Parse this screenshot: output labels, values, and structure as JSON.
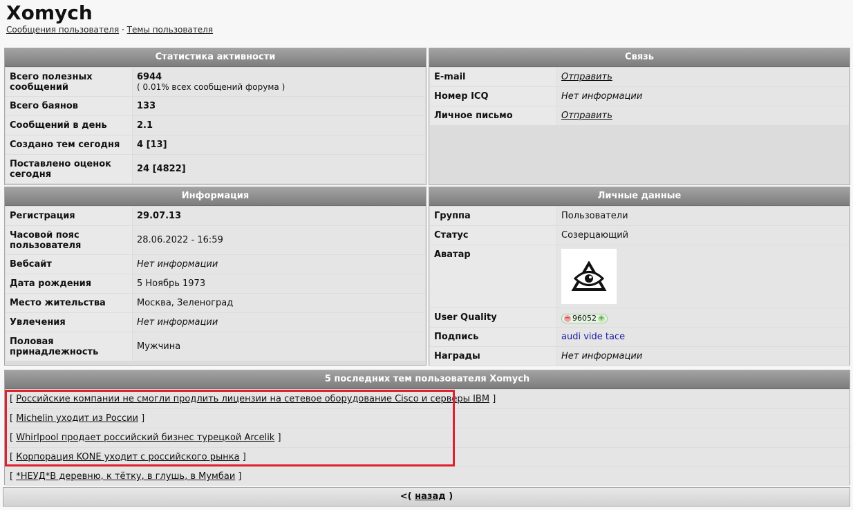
{
  "header": {
    "title": "Xomych",
    "link_posts": "Сообщения пользователя",
    "separator": "·",
    "link_topics": "Темы пользователя"
  },
  "activity": {
    "title": "Статистика активности",
    "rows": [
      {
        "label": "Всего полезных сообщений",
        "value": "6944",
        "sub": "( 0.01% всех сообщений форума )"
      },
      {
        "label": "Всего баянов",
        "value": "133"
      },
      {
        "label": "Сообщений в день",
        "value": "2.1"
      },
      {
        "label": "Создано тем сегодня",
        "value": "4 [13]"
      },
      {
        "label": "Поставлено оценок сегодня",
        "value": "24 [4822]"
      }
    ]
  },
  "contact": {
    "title": "Связь",
    "rows": [
      {
        "label": "E-mail",
        "value": "Отправить"
      },
      {
        "label": "Номер ICQ",
        "value": "Нет информации"
      },
      {
        "label": "Личное письмо",
        "value": "Отправить"
      }
    ]
  },
  "info": {
    "title": "Информация",
    "rows": [
      {
        "label": "Регистрация",
        "value": "29.07.13"
      },
      {
        "label": "Часовой пояс пользователя",
        "value": "28.06.2022 - 16:59"
      },
      {
        "label": "Вебсайт",
        "value": "Нет информации"
      },
      {
        "label": "Дата рождения",
        "value": "5 Ноябрь 1973"
      },
      {
        "label": "Место жительства",
        "value": "Москва, Зеленоград"
      },
      {
        "label": "Увлечения",
        "value": "Нет информации"
      },
      {
        "label": "Половая принадлежность",
        "value": "Мужчина"
      }
    ]
  },
  "personal": {
    "title": "Личные данные",
    "rows": [
      {
        "label": "Группа",
        "value": "Пользователи"
      },
      {
        "label": "Статус",
        "value": "Созерцающий"
      },
      {
        "label": "Аватар",
        "value": ""
      },
      {
        "label": "User Quality",
        "value": "96052"
      },
      {
        "label": "Подпись",
        "value": "audi vide tace"
      },
      {
        "label": "Награды",
        "value": "Нет информации"
      }
    ],
    "avatar_icon": "eye-in-triangle-icon"
  },
  "topics": {
    "title": "5 последних тем пользователя Xomych",
    "open": "[",
    "close": "]",
    "items": [
      "Российские компании не смогли продлить лицензии на сетевое оборудование Cisco и серверы IBM",
      "Michelin уходит из России",
      "Whirlpool продает российский бизнес турецкой Arcelik",
      "Корпорация KONE уходит с российского рынка",
      "*НЕУД*В деревню, к тётку, в глушь, в Мумбаи"
    ]
  },
  "footer": {
    "prefix": "<(",
    "back": "назад",
    "suffix": ")"
  },
  "colors": {
    "header_gradient_top": "#a3a3a3",
    "header_gradient_bottom": "#7d7d7d",
    "highlight": "#e0202e",
    "signature": "#1a1aa6"
  }
}
